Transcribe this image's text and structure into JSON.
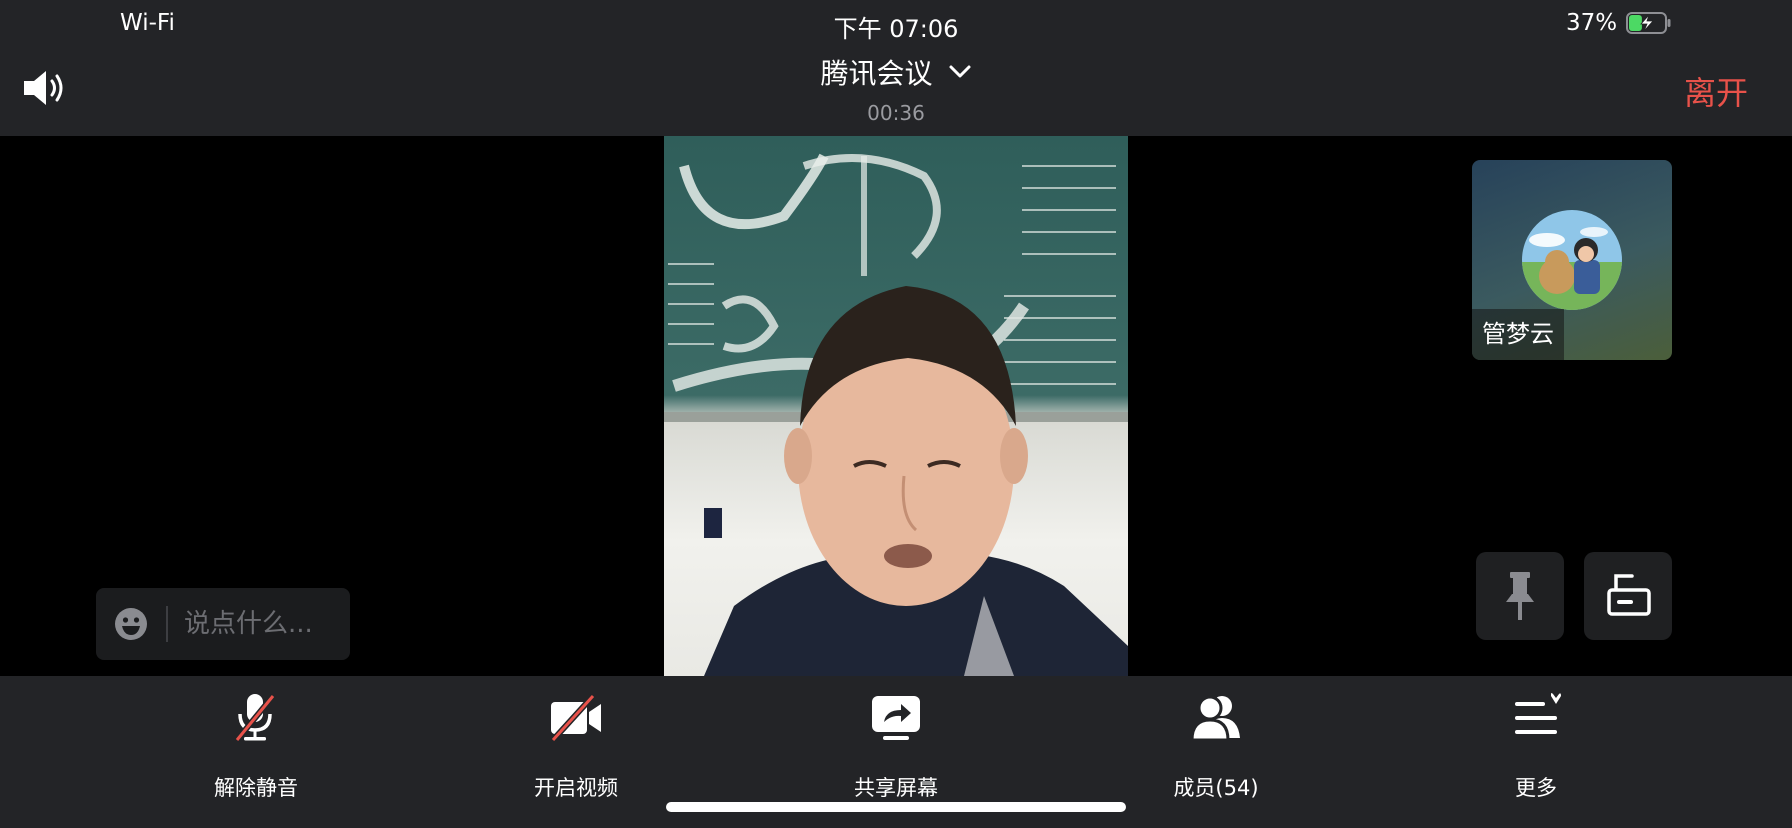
{
  "status_bar": {
    "network": "Wi-Fi",
    "time": "下午 07:06",
    "battery_percent": "37%",
    "battery_level": 0.37,
    "battery_charging": true
  },
  "header": {
    "meeting_title": "腾讯会议",
    "elapsed": "00:36",
    "leave_label": "离开",
    "leave_color": "#e8524a",
    "speaker_icon": "speaker-icon",
    "title_dropdown_icon": "chevron-down-icon"
  },
  "participant_tile": {
    "name": "管梦云"
  },
  "side_buttons": {
    "pin_icon": "pin-icon",
    "lock_icon": "unlock-icon"
  },
  "chat": {
    "placeholder": "说点什么...",
    "emoji_icon": "emoji-icon"
  },
  "toolbar": {
    "items": [
      {
        "label": "解除静音",
        "icon": "mic-muted-icon"
      },
      {
        "label": "开启视频",
        "icon": "camera-off-icon"
      },
      {
        "label": "共享屏幕",
        "icon": "share-screen-icon"
      },
      {
        "label": "成员(54)",
        "icon": "members-icon"
      },
      {
        "label": "更多",
        "icon": "more-menu-icon"
      }
    ],
    "muted_slash_color": "#e8524a"
  }
}
